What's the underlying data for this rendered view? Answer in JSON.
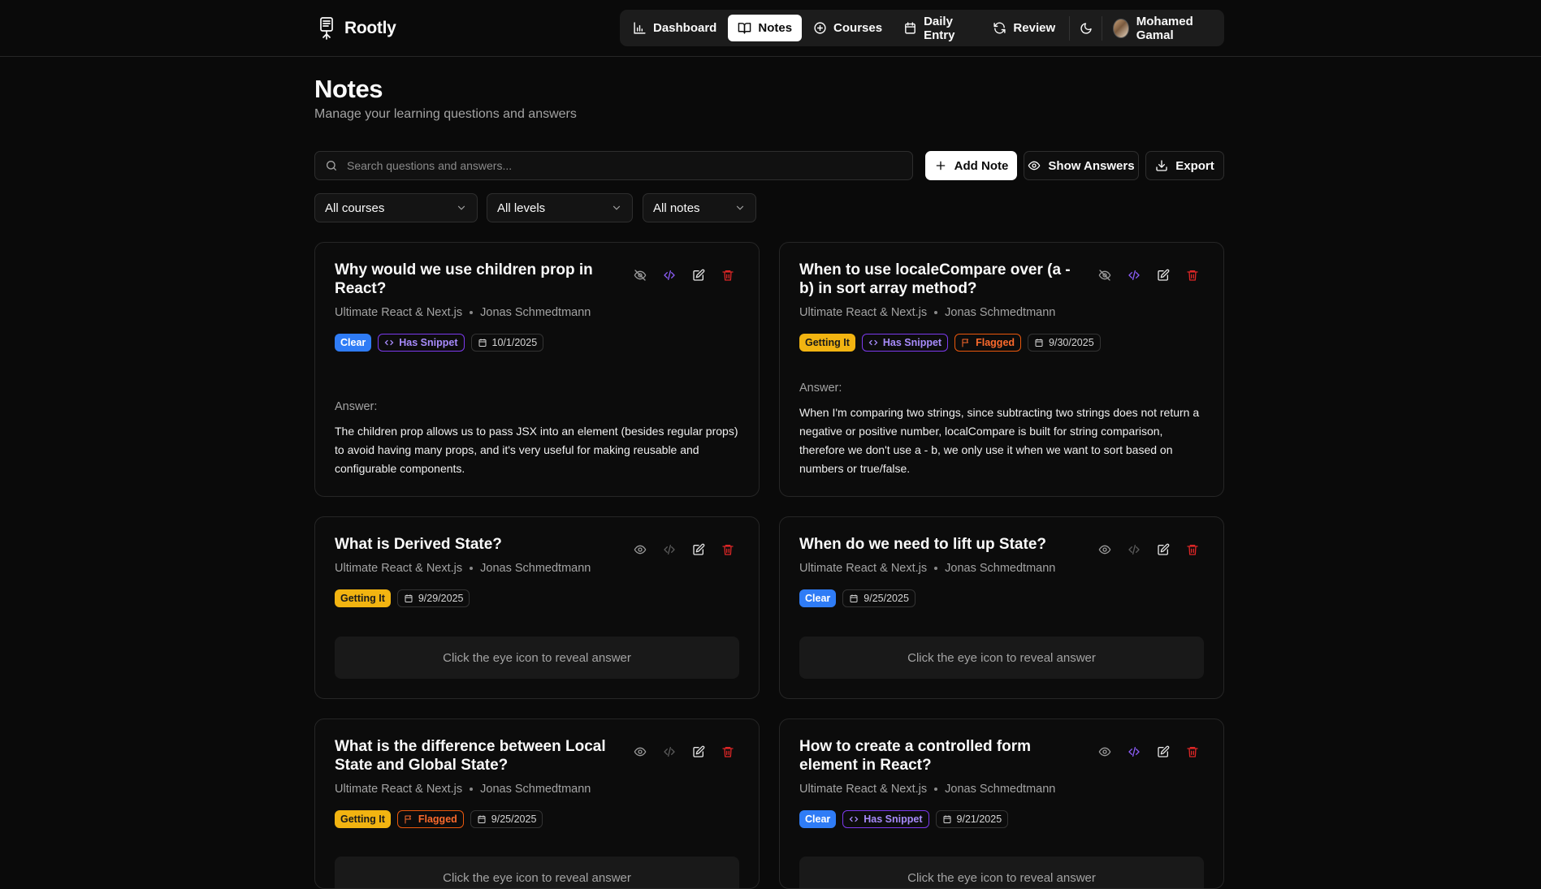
{
  "app": {
    "name": "Rootly"
  },
  "nav": {
    "items": [
      {
        "label": "Dashboard",
        "icon": "bar-chart-icon"
      },
      {
        "label": "Notes",
        "icon": "book-open-icon",
        "active": true
      },
      {
        "label": "Courses",
        "icon": "plus-circle-icon"
      },
      {
        "label": "Daily Entry",
        "icon": "calendar-icon"
      },
      {
        "label": "Review",
        "icon": "refresh-icon"
      }
    ],
    "theme_icon": "moon-icon",
    "user_name": "Mohamed Gamal"
  },
  "page": {
    "title": "Notes",
    "subtitle": "Manage your learning questions and answers"
  },
  "toolbar": {
    "search_placeholder": "Search questions and answers...",
    "add_label": "Add Note",
    "show_label": "Show Answers",
    "export_label": "Export"
  },
  "filters": {
    "course": "All courses",
    "level": "All levels",
    "notes": "All notes"
  },
  "colors": {
    "background": "#0a0a0a",
    "clear": "#2f7cf6",
    "getting_it": "#f2b411",
    "snippet": "#7c3aed",
    "flagged": "#ea580c",
    "delete": "#dc2626"
  },
  "notes": [
    {
      "question": "Why would we use children prop in React?",
      "course": "Ultimate React & Next.js",
      "instructor": "Jonas Schmedtmann",
      "level": "Clear",
      "snippet_label": "Has Snippet",
      "date": "10/1/2025",
      "answer_label": "Answer:",
      "answer": "The children prop allows us to pass JSX into an element (besides regular props) to avoid having many props, and it's very useful for making reusable and configurable components."
    },
    {
      "question": "When to use localeCompare over (a - b) in sort array method?",
      "course": "Ultimate React & Next.js",
      "instructor": "Jonas Schmedtmann",
      "level": "Getting It",
      "snippet_label": "Has Snippet",
      "flag_label": "Flagged",
      "date": "9/30/2025",
      "answer_label": "Answer:",
      "answer": "When I'm comparing two strings, since subtracting two strings does not return a negative or positive number, localCompare is built for string comparison, therefore we don't use a - b, we only use it when we want to sort based on numbers or true/false."
    },
    {
      "question": "What is Derived State?",
      "course": "Ultimate React & Next.js",
      "instructor": "Jonas Schmedtmann",
      "level": "Getting It",
      "date": "9/29/2025",
      "reveal": "Click the eye icon to reveal answer"
    },
    {
      "question": "When do we need to lift up State?",
      "course": "Ultimate React & Next.js",
      "instructor": "Jonas Schmedtmann",
      "level": "Clear",
      "date": "9/25/2025",
      "reveal": "Click the eye icon to reveal answer"
    },
    {
      "question": "What is the difference between Local State and Global State?",
      "course": "Ultimate React & Next.js",
      "instructor": "Jonas Schmedtmann",
      "level": "Getting It",
      "flag_label": "Flagged",
      "date": "9/25/2025",
      "reveal": "Click the eye icon to reveal answer"
    },
    {
      "question": "How to create a controlled form element in React?",
      "course": "Ultimate React & Next.js",
      "instructor": "Jonas Schmedtmann",
      "level": "Clear",
      "snippet_label": "Has Snippet",
      "date": "9/21/2025",
      "reveal": "Click the eye icon to reveal answer"
    }
  ]
}
